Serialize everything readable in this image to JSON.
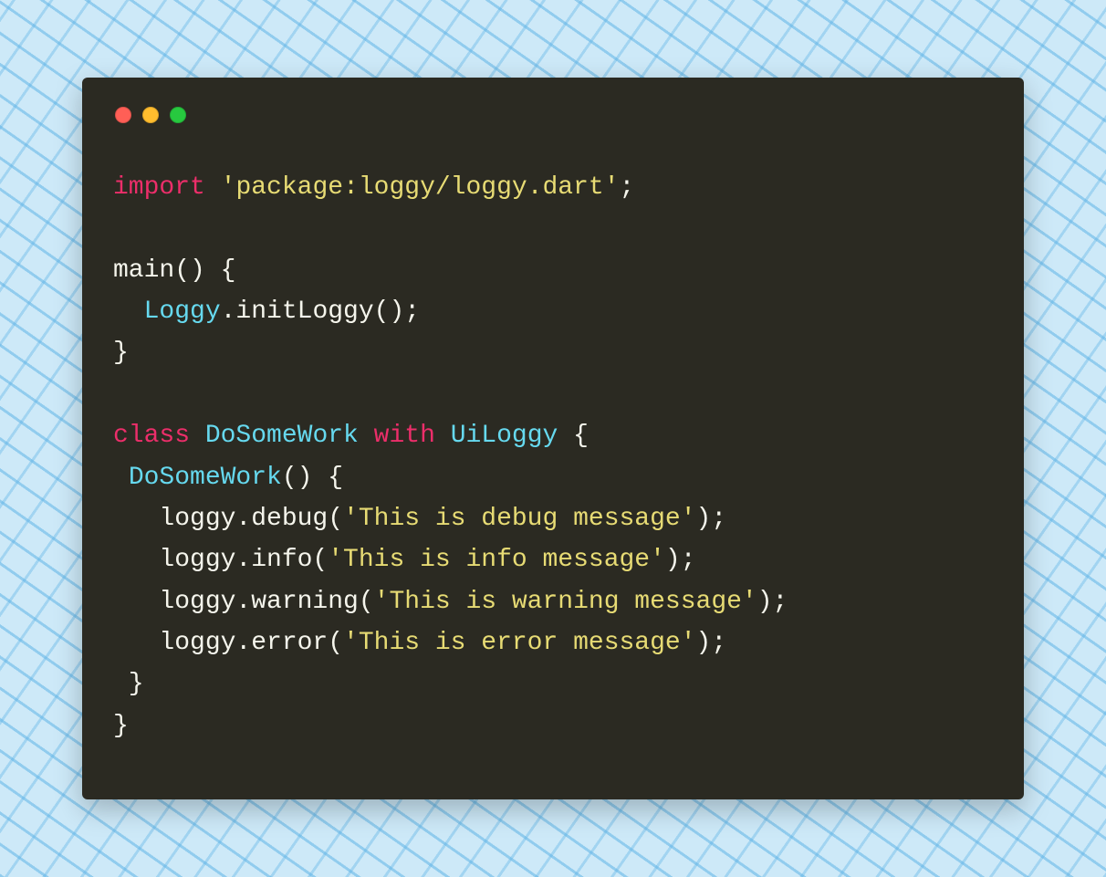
{
  "code": {
    "lines": [
      [
        {
          "cls": "tok-keyword",
          "t": "import"
        },
        {
          "cls": "tok-default",
          "t": " "
        },
        {
          "cls": "tok-string",
          "t": "'package:loggy/loggy.dart'"
        },
        {
          "cls": "tok-default",
          "t": ";"
        }
      ],
      [],
      [
        {
          "cls": "tok-default",
          "t": "main() {"
        }
      ],
      [
        {
          "cls": "tok-default",
          "t": "  "
        },
        {
          "cls": "tok-type",
          "t": "Loggy"
        },
        {
          "cls": "tok-default",
          "t": ".initLoggy();"
        }
      ],
      [
        {
          "cls": "tok-default",
          "t": "}"
        }
      ],
      [],
      [
        {
          "cls": "tok-keyword",
          "t": "class"
        },
        {
          "cls": "tok-default",
          "t": " "
        },
        {
          "cls": "tok-type",
          "t": "DoSomeWork"
        },
        {
          "cls": "tok-default",
          "t": " "
        },
        {
          "cls": "tok-keyword",
          "t": "with"
        },
        {
          "cls": "tok-default",
          "t": " "
        },
        {
          "cls": "tok-type",
          "t": "UiLoggy"
        },
        {
          "cls": "tok-default",
          "t": " {"
        }
      ],
      [
        {
          "cls": "tok-default",
          "t": " "
        },
        {
          "cls": "tok-type",
          "t": "DoSomeWork"
        },
        {
          "cls": "tok-default",
          "t": "() {"
        }
      ],
      [
        {
          "cls": "tok-default",
          "t": "   loggy.debug("
        },
        {
          "cls": "tok-string",
          "t": "'This is debug message'"
        },
        {
          "cls": "tok-default",
          "t": ");"
        }
      ],
      [
        {
          "cls": "tok-default",
          "t": "   loggy.info("
        },
        {
          "cls": "tok-string",
          "t": "'This is info message'"
        },
        {
          "cls": "tok-default",
          "t": ");"
        }
      ],
      [
        {
          "cls": "tok-default",
          "t": "   loggy.warning("
        },
        {
          "cls": "tok-string",
          "t": "'This is warning message'"
        },
        {
          "cls": "tok-default",
          "t": ");"
        }
      ],
      [
        {
          "cls": "tok-default",
          "t": "   loggy.error("
        },
        {
          "cls": "tok-string",
          "t": "'This is error message'"
        },
        {
          "cls": "tok-default",
          "t": ");"
        }
      ],
      [
        {
          "cls": "tok-default",
          "t": " }"
        }
      ],
      [
        {
          "cls": "tok-default",
          "t": "}"
        }
      ]
    ]
  }
}
